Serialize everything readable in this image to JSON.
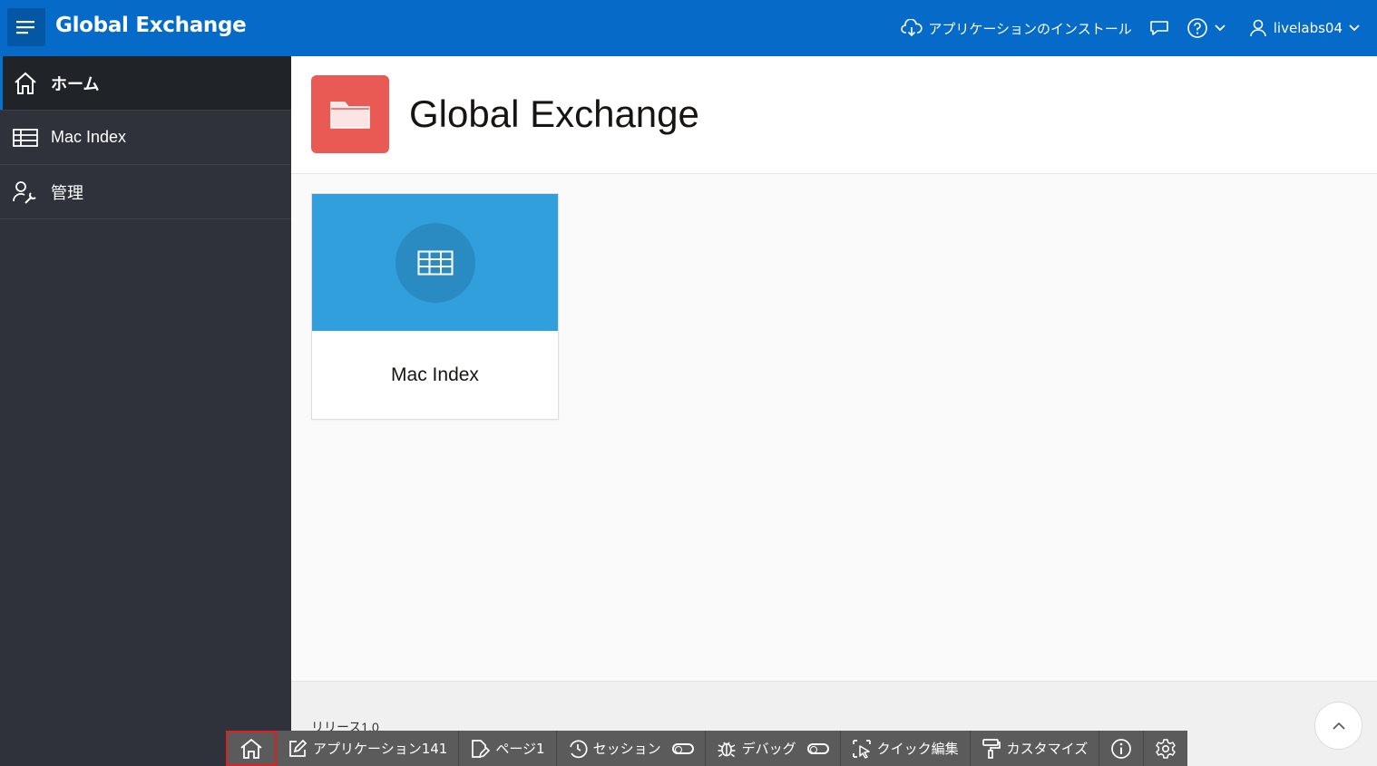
{
  "header": {
    "app_title": "Global Exchange",
    "install_label": "アプリケーションのインストール",
    "user_label": "livelabs04"
  },
  "sidebar": {
    "items": [
      {
        "label": "ホーム",
        "icon": "home-icon",
        "active": true
      },
      {
        "label": "Mac Index",
        "icon": "table-icon",
        "active": false
      },
      {
        "label": "管理",
        "icon": "user-wrench-icon",
        "active": false
      }
    ]
  },
  "hero": {
    "title": "Global Exchange",
    "icon": "folder-icon"
  },
  "cards": [
    {
      "label": "Mac Index",
      "icon": "table-icon"
    }
  ],
  "footer": {
    "release": "リリース1.0"
  },
  "devbar": {
    "app_label": "アプリケーション141",
    "page_label": "ページ1",
    "session_label": "セッション",
    "debug_label": "デバッグ",
    "quick_edit_label": "クイック編集",
    "customize_label": "カスタマイズ"
  },
  "colors": {
    "header_bg": "#056ac8",
    "sidebar_bg": "#2f323b",
    "hero_icon_bg": "#ea5a54",
    "card_top_bg": "#309fdb",
    "devbar_bg": "#5b5b5b",
    "highlight": "#e02020"
  }
}
